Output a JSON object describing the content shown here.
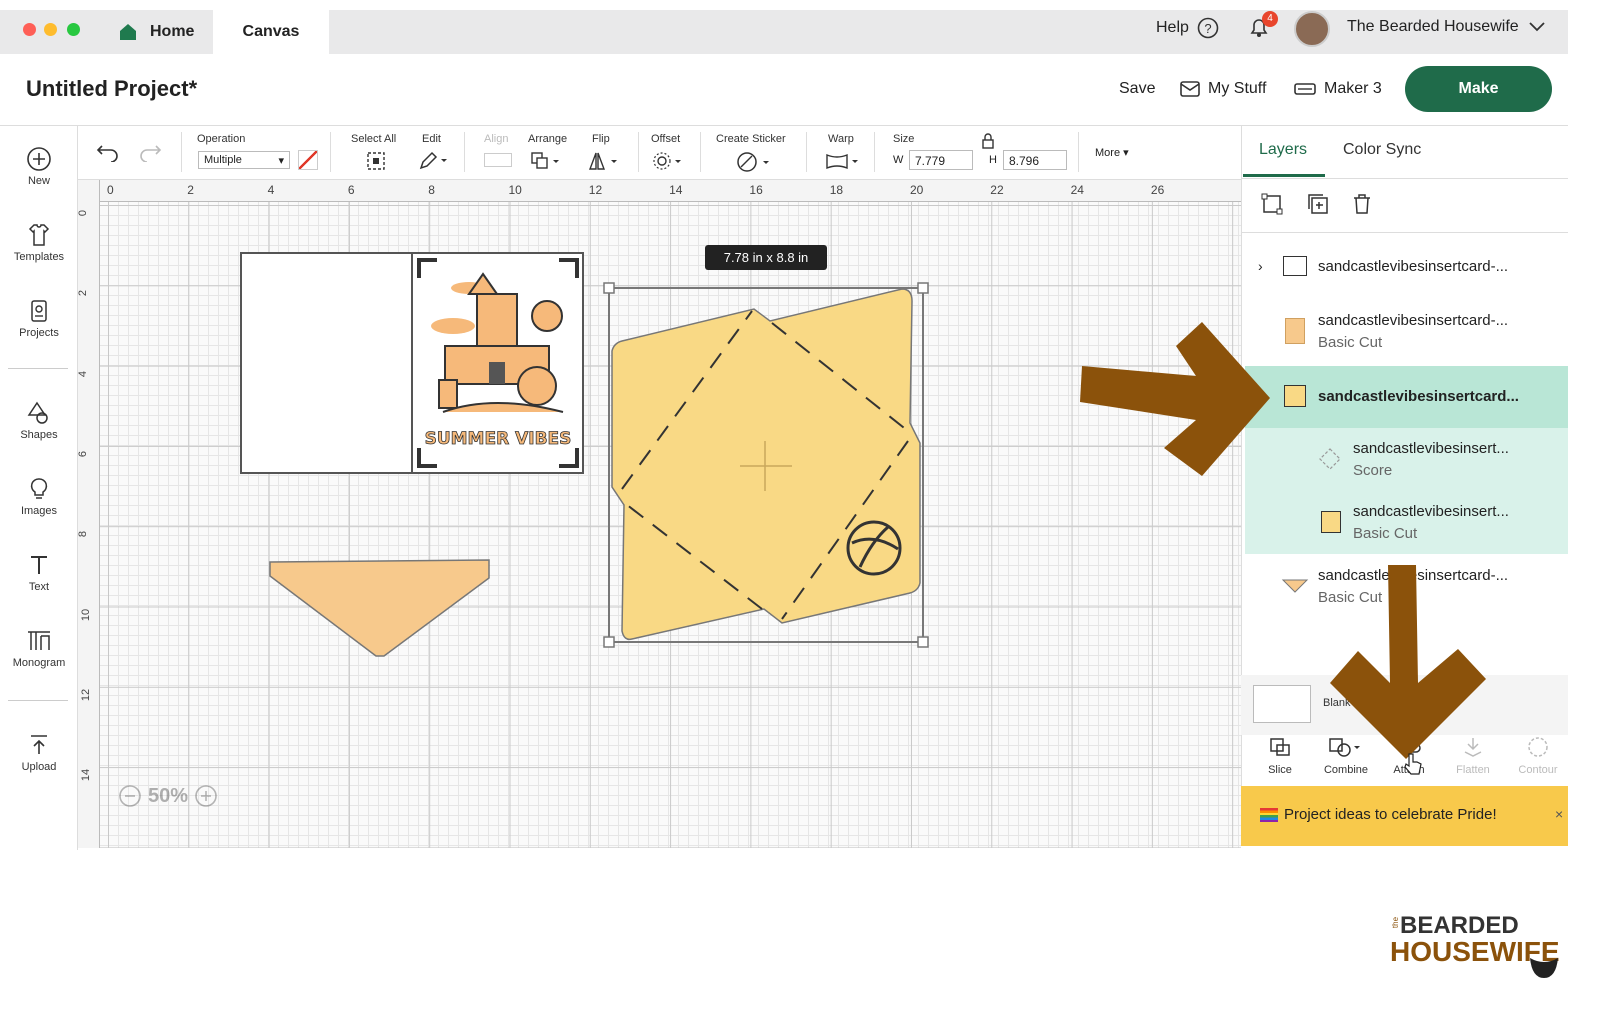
{
  "tabs": {
    "home": "Home",
    "canvas": "Canvas"
  },
  "topbar": {
    "help": "Help",
    "notification_count": "4",
    "user_name": "The Bearded Housewife"
  },
  "header": {
    "project_title": "Untitled Project*",
    "save": "Save",
    "my_stuff": "My Stuff",
    "machine": "Maker 3",
    "make": "Make"
  },
  "sidebar": {
    "items": [
      {
        "label": "New",
        "icon": "plus-circle-icon"
      },
      {
        "label": "Templates",
        "icon": "shirt-icon"
      },
      {
        "label": "Projects",
        "icon": "projects-icon"
      },
      {
        "label": "Shapes",
        "icon": "shapes-icon"
      },
      {
        "label": "Images",
        "icon": "bulb-icon"
      },
      {
        "label": "Text",
        "icon": "text-icon"
      },
      {
        "label": "Monogram",
        "icon": "monogram-icon"
      },
      {
        "label": "Upload",
        "icon": "upload-icon"
      }
    ]
  },
  "toolbar": {
    "operation_label": "Operation",
    "operation_value": "Multiple",
    "select_all": "Select All",
    "edit": "Edit",
    "align": "Align",
    "arrange": "Arrange",
    "flip": "Flip",
    "offset": "Offset",
    "create_sticker": "Create Sticker",
    "warp": "Warp",
    "size": "Size",
    "w_label": "W",
    "w_value": "7.779",
    "h_label": "H",
    "h_value": "8.796",
    "more": "More"
  },
  "canvas": {
    "ruler_top": [
      "0",
      "2",
      "4",
      "6",
      "8",
      "10",
      "12",
      "14",
      "16",
      "18",
      "20",
      "22",
      "24",
      "26"
    ],
    "ruler_left": [
      "0",
      "2",
      "4",
      "6",
      "8",
      "10",
      "12",
      "14"
    ],
    "size_tooltip": "7.78  in x 8.8  in",
    "zoom": "50%",
    "card_text": "SUMMER VIBES"
  },
  "panel": {
    "tabs": {
      "layers": "Layers",
      "color_sync": "Color Sync"
    },
    "layers": [
      {
        "name": "sandcastlevibesinsertcard-...",
        "sub": ""
      },
      {
        "name": "sandcastlevibesinsertcard-...",
        "sub": "Basic Cut"
      },
      {
        "name": "sandcastlevibesinsertcard...",
        "sub": ""
      },
      {
        "name": "sandcastlevibesinsert...",
        "sub": "Score"
      },
      {
        "name": "sandcastlevibesinsert...",
        "sub": "Basic Cut"
      },
      {
        "name": "sandcastlevibesinsertcard-...",
        "sub": "Basic Cut"
      }
    ],
    "blank_label": "Blank",
    "actions": [
      "Slice",
      "Combine",
      "Attach",
      "Flatten",
      "Contour"
    ],
    "banner": "Project ideas to celebrate Pride!"
  },
  "branding": {
    "logo_top": "BEARDED",
    "logo_the": "the",
    "logo_bottom": "HOUSEWIFE"
  },
  "colors": {
    "make": "#1f6b4a",
    "layer_selected": "#d9f2ea",
    "arrow": "#8b520b",
    "envelope": "#f9d985",
    "banner": "#f8c94b",
    "accent_green": "#1f6b4a"
  }
}
